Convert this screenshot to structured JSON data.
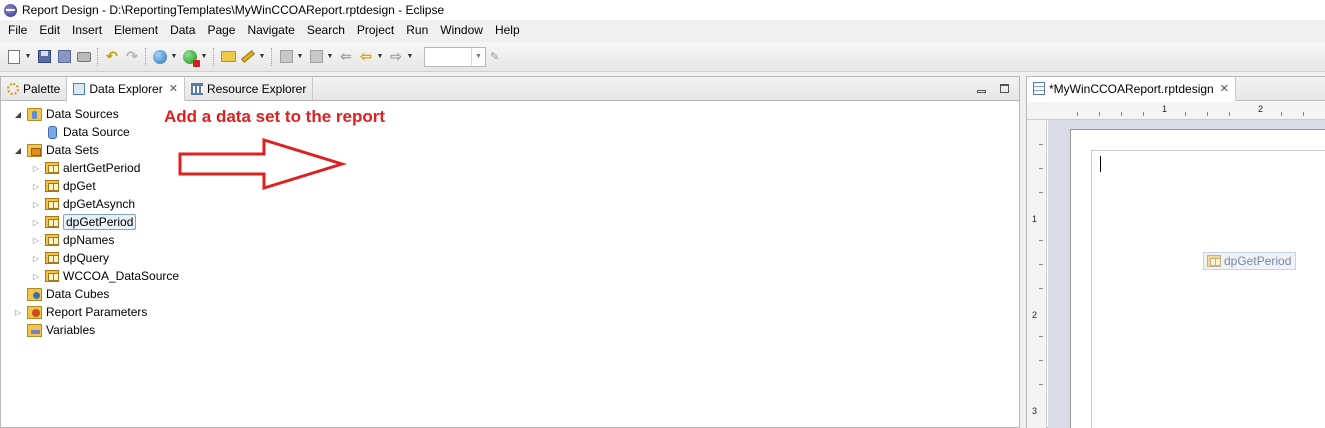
{
  "window": {
    "title": "Report Design - D:\\ReportingTemplates\\MyWinCCOAReport.rptdesign - Eclipse"
  },
  "menubar": [
    "File",
    "Edit",
    "Insert",
    "Element",
    "Data",
    "Page",
    "Navigate",
    "Search",
    "Project",
    "Run",
    "Window",
    "Help"
  ],
  "left_panel": {
    "tabs": [
      {
        "label": "Palette",
        "icon": "palette-icon"
      },
      {
        "label": "Data Explorer",
        "icon": "data-explorer-icon",
        "active": true
      },
      {
        "label": "Resource Explorer",
        "icon": "resource-explorer-icon"
      }
    ],
    "tree": {
      "data_sources": {
        "label": "Data Sources",
        "children": [
          "Data Source"
        ]
      },
      "data_sets": {
        "label": "Data Sets",
        "children": [
          "alertGetPeriod",
          "dpGet",
          "dpGetAsynch",
          "dpGetPeriod",
          "dpNames",
          "dpQuery",
          "WCCOA_DataSource"
        ],
        "selected": "dpGetPeriod"
      },
      "data_cubes": "Data Cubes",
      "report_parameters": "Report Parameters",
      "variables": "Variables"
    }
  },
  "annotation": {
    "text": "Add a data set to the report",
    "color": "#e02020"
  },
  "editor": {
    "tab_label": "*MyWinCCOAReport.rptdesign",
    "ruler_h_numbers": [
      "1",
      "2"
    ],
    "ruler_v_numbers": [
      "1",
      "2",
      "3"
    ],
    "drag_item_label": "dpGetPeriod"
  }
}
